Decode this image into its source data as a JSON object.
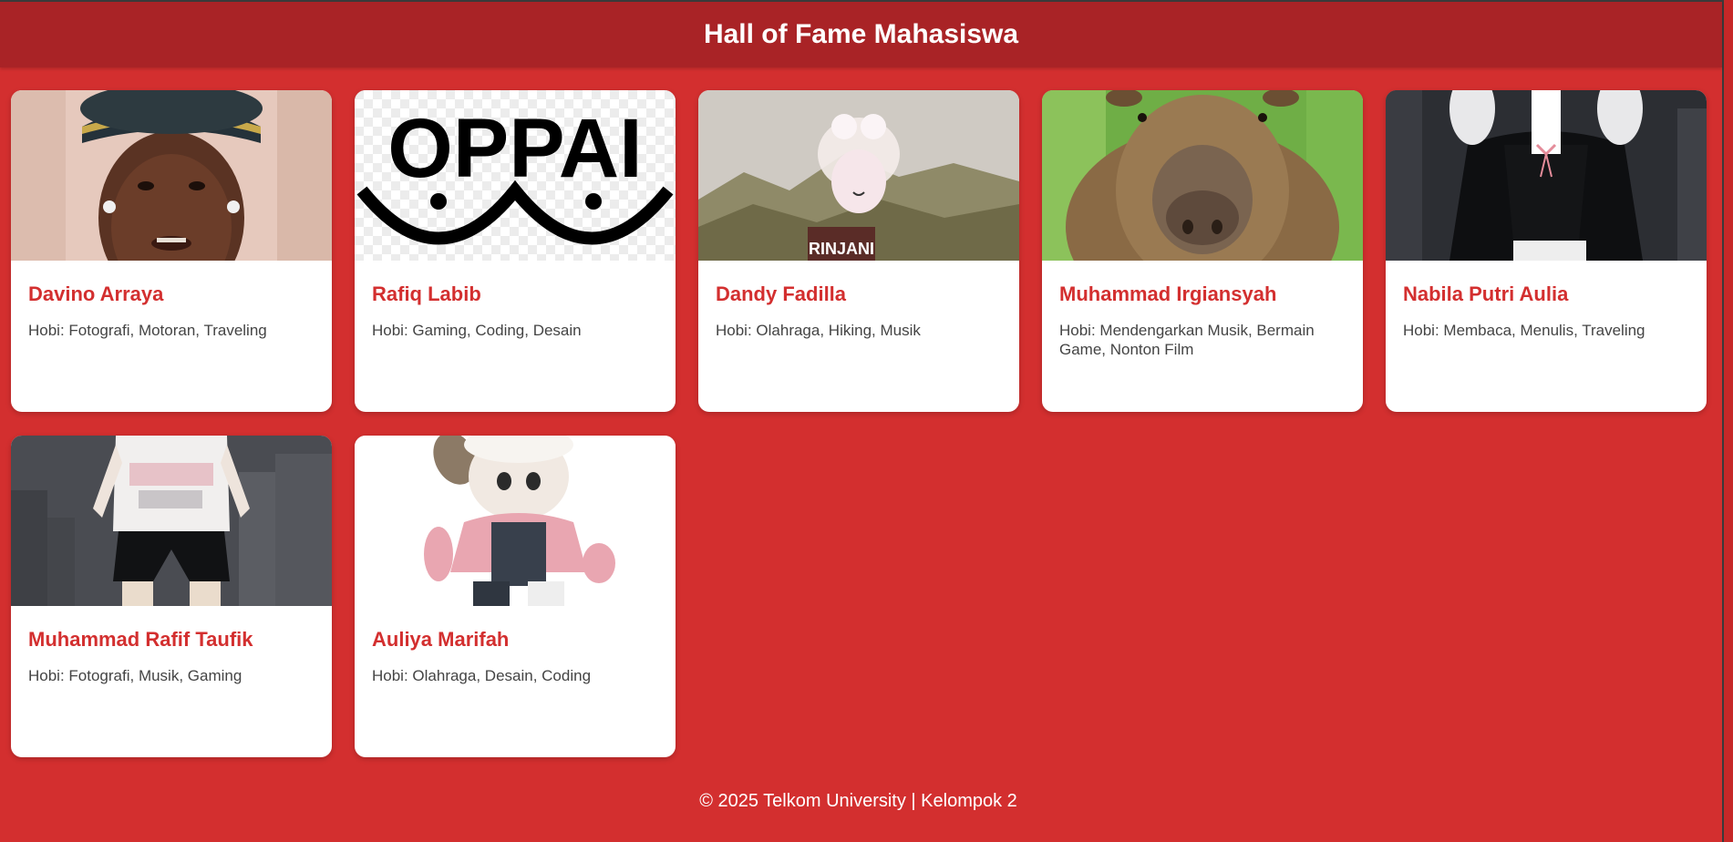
{
  "header": {
    "title": "Hall of Fame Mahasiswa"
  },
  "cards": [
    {
      "name": "Davino Arraya",
      "hobby": "Hobi: Fotografi, Motoran, Traveling",
      "photo": "portrait-with-cap"
    },
    {
      "name": "Rafiq Labib",
      "hobby": "Hobi: Gaming, Coding, Desain",
      "photo": "oppai-logo",
      "photo_text": "OPPAI"
    },
    {
      "name": "Dandy Fadilla",
      "hobby": "Hobi: Olahraga, Hiking, Musik",
      "photo": "mountain-avatar",
      "photo_text": "RINJANI"
    },
    {
      "name": "Muhammad Irgiansyah",
      "hobby": "Hobi: Mendengarkan Musik, Bermain Game, Nonton Film",
      "photo": "capybara"
    },
    {
      "name": "Nabila Putri Aulia",
      "hobby": "Hobi: Membaca, Menulis, Traveling",
      "photo": "avatar-black-outfit"
    },
    {
      "name": "Muhammad Rafif Taufik",
      "hobby": "Hobi: Fotografi, Musik, Gaming",
      "photo": "avatar-white-shirt"
    },
    {
      "name": "Auliya Marifah",
      "hobby": "Hobi: Olahraga, Desain, Coding",
      "photo": "avatar-pink-jacket"
    }
  ],
  "footer": {
    "text": "© 2025 Telkom University | Kelompok 2"
  },
  "colors": {
    "background": "#d32f2f",
    "header": "#a92326",
    "name": "#d32f2f",
    "card": "#ffffff"
  }
}
